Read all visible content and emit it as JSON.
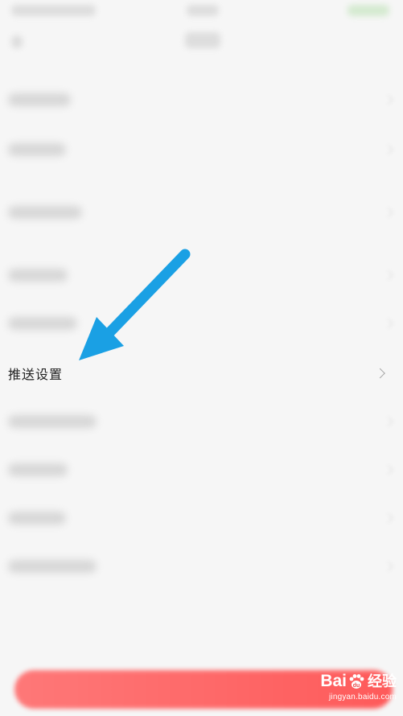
{
  "settings": {
    "highlighted_item": {
      "label": "推送设置"
    }
  },
  "watermark": {
    "brand_left": "Bai",
    "brand_right": "经验",
    "url": "jingyan.baidu.com"
  },
  "colors": {
    "arrow": "#1aa0e4",
    "bottom_button": "#ff4d4d",
    "background": "#f6f6f6"
  },
  "icons": {
    "chevron": "chevron-right-icon",
    "arrow": "pointer-arrow-icon",
    "paw": "baidu-paw-icon"
  }
}
